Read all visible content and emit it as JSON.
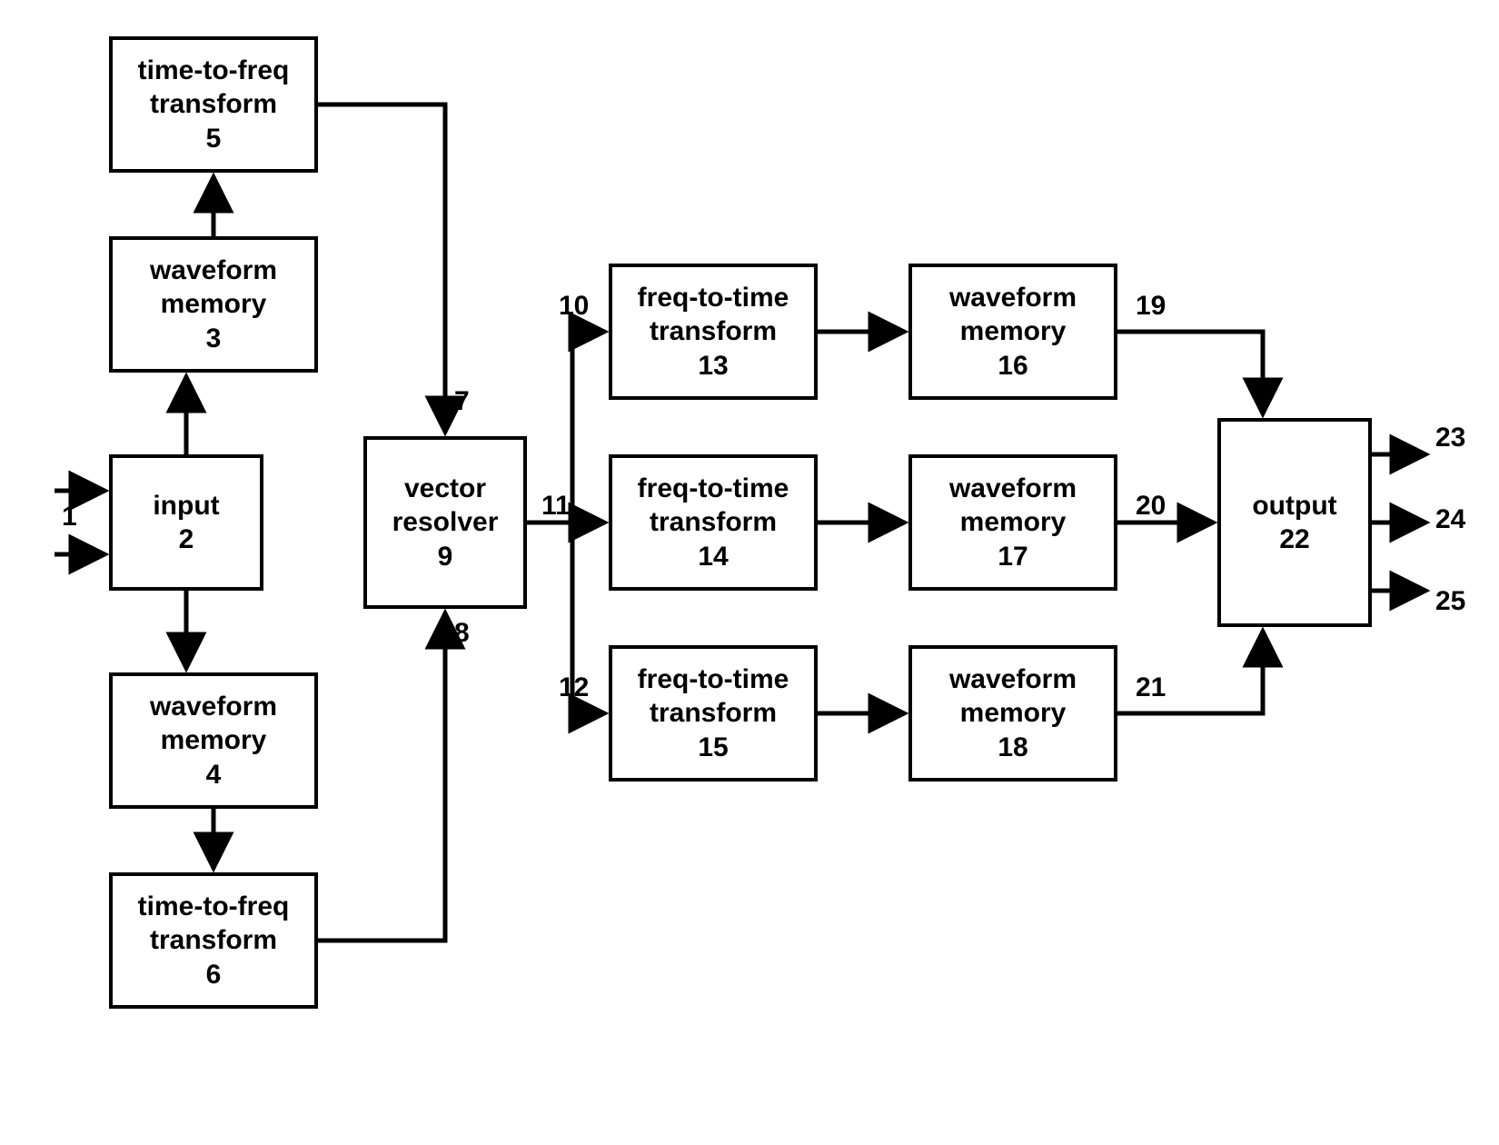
{
  "blocks": {
    "input": {
      "line1": "input",
      "num": "2"
    },
    "wave_mem_3": {
      "line1": "waveform",
      "line2": "memory",
      "num": "3"
    },
    "wave_mem_4": {
      "line1": "waveform",
      "line2": "memory",
      "num": "4"
    },
    "ttf_5": {
      "line1": "time-to-freq",
      "line2": "transform",
      "num": "5"
    },
    "ttf_6": {
      "line1": "time-to-freq",
      "line2": "transform",
      "num": "6"
    },
    "vector_resolver": {
      "line1": "vector",
      "line2": "resolver",
      "num": "9"
    },
    "ftt_13": {
      "line1": "freq-to-time",
      "line2": "transform",
      "num": "13"
    },
    "ftt_14": {
      "line1": "freq-to-time",
      "line2": "transform",
      "num": "14"
    },
    "ftt_15": {
      "line1": "freq-to-time",
      "line2": "transform",
      "num": "15"
    },
    "wave_mem_16": {
      "line1": "waveform",
      "line2": "memory",
      "num": "16"
    },
    "wave_mem_17": {
      "line1": "waveform",
      "line2": "memory",
      "num": "17"
    },
    "wave_mem_18": {
      "line1": "waveform",
      "line2": "memory",
      "num": "18"
    },
    "output": {
      "line1": "output",
      "num": "22"
    }
  },
  "labels": {
    "l1": "1",
    "l7": "7",
    "l8": "8",
    "l10": "10",
    "l11": "11",
    "l12": "12",
    "l19": "19",
    "l20": "20",
    "l21": "21",
    "l23": "23",
    "l24": "24",
    "l25": "25"
  }
}
